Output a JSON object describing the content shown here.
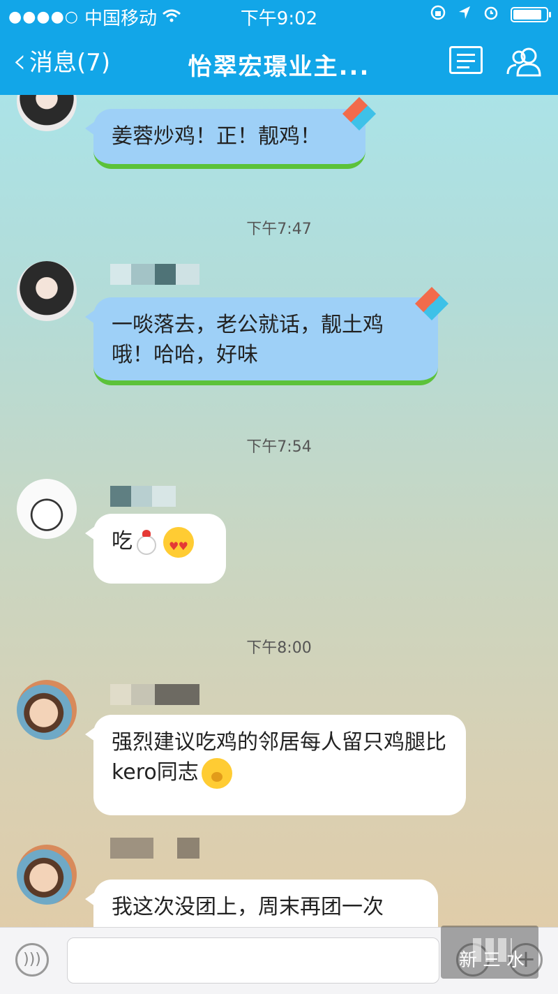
{
  "status_bar": {
    "signal": "●●●●○",
    "carrier": "中国移动",
    "time": "下午9:02"
  },
  "header": {
    "back_label": "消息(7)",
    "title": "怡翠宏璟业主..."
  },
  "messages": [
    {
      "type": "bubble",
      "style": "blue",
      "text": "姜蓉炒鸡！正！靓鸡！"
    },
    {
      "type": "timestamp",
      "text": "下午7:47"
    },
    {
      "type": "bubble",
      "style": "blue",
      "text": "一啖落去，老公就话，靓土鸡哦！哈哈，好味"
    },
    {
      "type": "timestamp",
      "text": "下午7:54"
    },
    {
      "type": "bubble",
      "style": "white",
      "text": "吃",
      "icons": [
        "chicken-emoji",
        "heart-eyes-emoji"
      ]
    },
    {
      "type": "timestamp",
      "text": "下午8:00"
    },
    {
      "type": "bubble",
      "style": "white",
      "text": "强烈建议吃鸡的邻居每人留只鸡腿比kero同志",
      "icons": [
        "thinking-emoji"
      ]
    },
    {
      "type": "bubble",
      "style": "white",
      "text": "我这次没团上，周末再团一次"
    }
  ],
  "watermark": {
    "text": "新三水"
  },
  "colors": {
    "header_bg": "#12a6e8",
    "blue_bubble": "#9ed0f7",
    "bubble_underline": "#5cc23a"
  }
}
